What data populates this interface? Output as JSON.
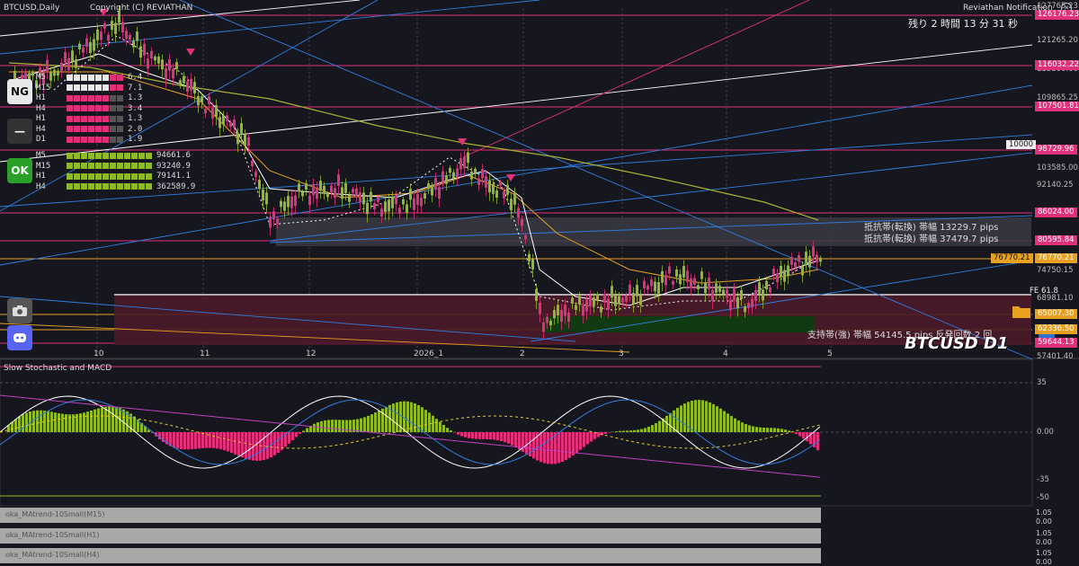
{
  "header": {
    "symbol": "BTCUSD,Daily",
    "copyright": "Copyright (C) REVIATHAN",
    "notification": "Reviathan Notification",
    "countdown": "残り 2 時間 13 分 31 秒"
  },
  "price_levels": [
    {
      "value": "126176.23",
      "color": "#e0307a"
    },
    {
      "value": "116032.22",
      "color": "#e0307a"
    },
    {
      "value": "107501.81",
      "color": "#e0307a"
    },
    {
      "value": "98729.96",
      "color": "#e0307a"
    },
    {
      "value": "86024.00",
      "color": "#e0307a"
    },
    {
      "value": "80595.84",
      "color": "#e0307a"
    },
    {
      "value": "76770.21",
      "color": "#e8a020"
    },
    {
      "value": "65007.30",
      "color": "#e8a020"
    },
    {
      "value": "62336.50",
      "color": "#e8a020"
    },
    {
      "value": "59644.13",
      "color": "#e0307a"
    }
  ],
  "axis_prices": [
    "127765.23",
    "121265.20",
    "115300.00",
    "109865.25",
    "103585.00",
    "92140.25",
    "76770.21",
    "74750.15",
    "68981.10",
    "57401.40"
  ],
  "round_level": "10000",
  "fe_label": "FE 61.8",
  "dates": [
    "10",
    "11",
    "12",
    "2026_1",
    "2",
    "3",
    "4",
    "5"
  ],
  "resistance": [
    "抵抗帯(転換) 帯幅 13229.7 pips",
    "抵抗帯(転換) 帯幅 37479.7 pips"
  ],
  "support": "支持帯(強) 帯幅 54145.5 pips  反発回数 2 回",
  "watermark": "BTCUSD D1",
  "dashboard": {
    "ng_label": "NG",
    "ok_label": "OK",
    "dash_label": "—",
    "ng_rows": [
      {
        "tf": "M5",
        "val": "6.4"
      },
      {
        "tf": "M15",
        "val": "7.1"
      },
      {
        "tf": "H1",
        "val": "1.3"
      },
      {
        "tf": "H4",
        "val": "3.4"
      },
      {
        "tf": "H1",
        "val": "1.3"
      },
      {
        "tf": "H4",
        "val": "2.0"
      },
      {
        "tf": "D1",
        "val": "1.9"
      }
    ],
    "ok_rows": [
      {
        "tf": "M5",
        "val": "94661.6"
      },
      {
        "tf": "M15",
        "val": "93240.9"
      },
      {
        "tf": "H1",
        "val": "79141.1"
      },
      {
        "tf": "H4",
        "val": "362589.9"
      }
    ]
  },
  "sub_panel": {
    "title": "Slow Stochastic and MACD",
    "axis": [
      "35",
      "0.00",
      "-35",
      "-50"
    ]
  },
  "bottom_indicators": [
    {
      "name": "oka_MAtrend-10Small(M15)",
      "top": "1.05",
      "bottom": "0.00"
    },
    {
      "name": "oka_MAtrend-10Small(H1)",
      "top": "1.05",
      "bottom": "0.00"
    },
    {
      "name": "oka_MAtrend-10Small(H4)",
      "top": "1.05",
      "bottom": "0.00"
    }
  ],
  "icons": {
    "camera": "camera-icon",
    "discord": "discord-icon",
    "folder": "folder-icon",
    "save": "save-icon",
    "close": "close-icon"
  },
  "colors": {
    "background": "#16161f",
    "bull": "#8fb82a",
    "bear": "#e0307a",
    "resistance_line": "#e0307a",
    "trend_blue": "#2f7fe0",
    "price_tag": "#e8a020"
  }
}
